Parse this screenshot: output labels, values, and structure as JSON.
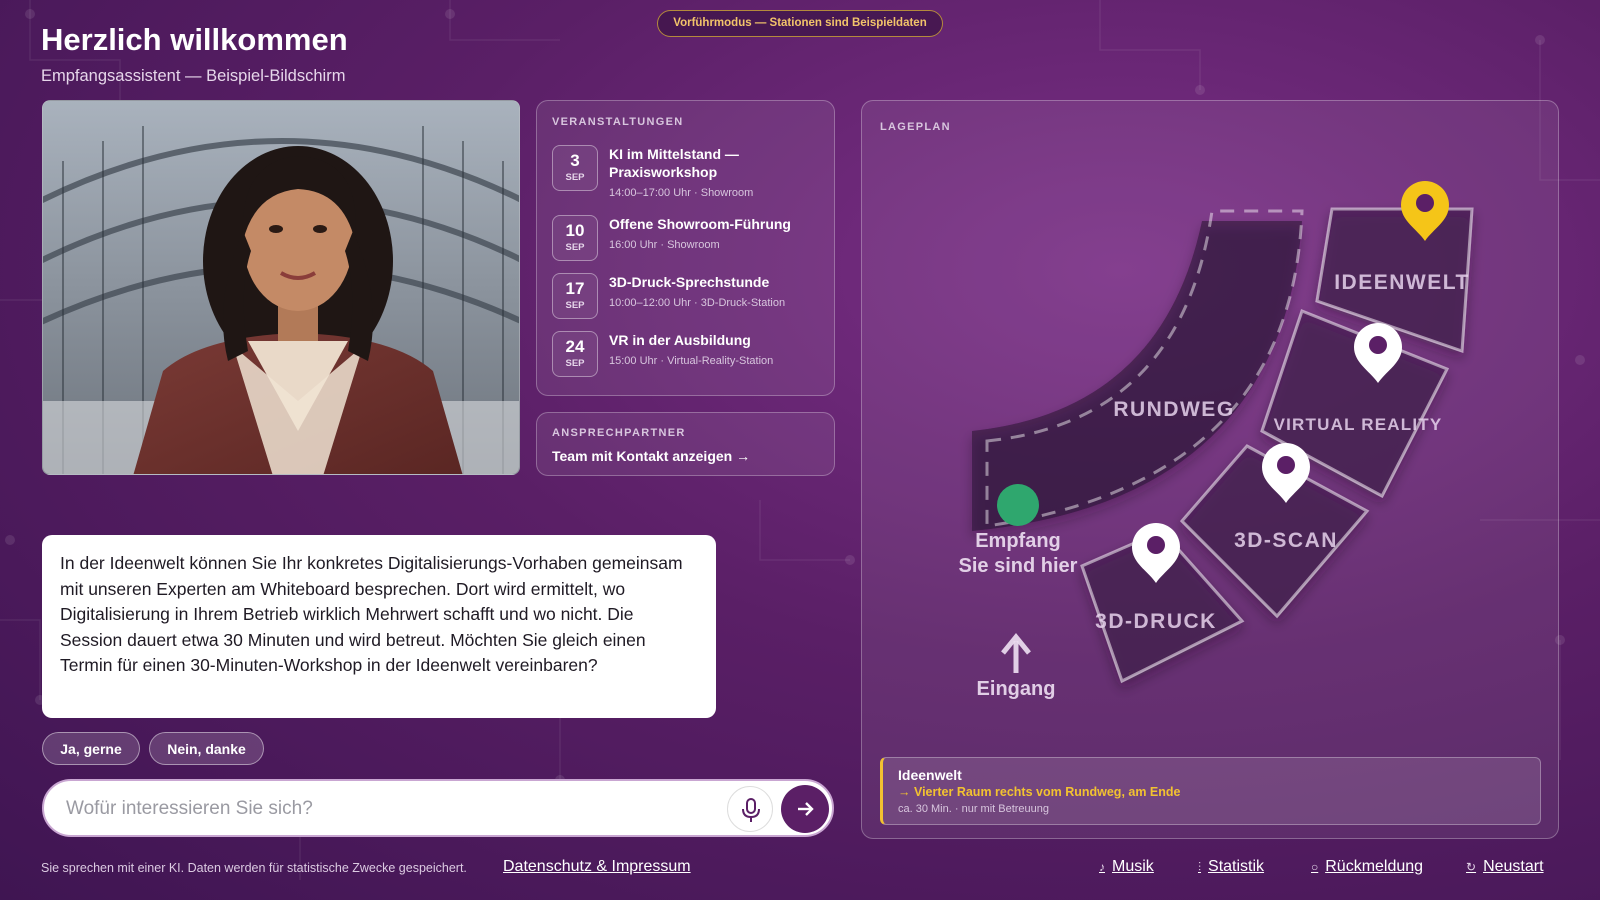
{
  "demo_badge": "Vorführmodus — Stationen sind Beispieldaten",
  "header": {
    "title": "Herzlich willkommen",
    "subtitle": "Empfangsassistent — Beispiel-Bildschirm"
  },
  "events": {
    "heading": "VERANSTALTUNGEN",
    "items": [
      {
        "day": "3",
        "month": "SEP",
        "title": "KI im Mittelstand — Praxisworkshop",
        "meta": "14:00–17:00 Uhr · Showroom"
      },
      {
        "day": "10",
        "month": "SEP",
        "title": "Offene Showroom-Führung",
        "meta": "16:00 Uhr · Showroom"
      },
      {
        "day": "17",
        "month": "SEP",
        "title": "3D-Druck-Sprechstunde",
        "meta": "10:00–12:00 Uhr · 3D-Druck-Station"
      },
      {
        "day": "24",
        "month": "SEP",
        "title": "VR in der Ausbildung",
        "meta": "15:00 Uhr · Virtual-Reality-Station"
      }
    ]
  },
  "contact": {
    "heading": "ANSPRECHPARTNER",
    "link": "Team mit Kontakt anzeigen →"
  },
  "chat": {
    "message": "In der Ideenwelt können Sie Ihr konkretes Digitalisierungs-Vorhaben gemeinsam mit unseren Experten am Whiteboard besprechen. Dort wird ermittelt, wo Digitalisierung in Ihrem Betrieb wirklich Mehrwert schafft und wo nicht. Die Session dauert etwa 30 Minuten und wird betreut. Möchten Sie gleich einen Termin für einen 30-Minuten-Workshop in der Ideenwelt vereinbaren?",
    "reply_yes": "Ja, gerne",
    "reply_no": "Nein, danke",
    "input_placeholder": "Wofür interessieren Sie sich?",
    "mic_icon": "microphone-icon",
    "send_icon": "arrow-right-icon"
  },
  "map": {
    "heading": "LAGEPLAN",
    "labels": {
      "rundweg": "RUNDWEG",
      "ideenwelt": "IDEENWELT",
      "virtual_reality": "VIRTUAL REALITY",
      "scan": "3D-SCAN",
      "druck": "3D-DRUCK",
      "empfang": "Empfang",
      "here": "Sie sind hier",
      "eingang": "Eingang"
    },
    "colors": {
      "highlight_pin": "#f5c518",
      "you_are_here": "#2fa76e"
    },
    "info": {
      "title": "Ideenwelt",
      "direction": "→ Vierter Raum rechts vom Rundweg, am Ende",
      "meta": "ca. 30 Min. · nur mit Betreuung"
    }
  },
  "footer": {
    "note": "Sie sprechen mit einer KI. Daten werden für statistische Zwecke gespeichert.",
    "privacy_link": "Datenschutz & Impressum",
    "items": [
      {
        "icon": "♪",
        "label": "Musik"
      },
      {
        "icon": "⫶",
        "label": "Statistik"
      },
      {
        "icon": "○",
        "label": "Rückmeldung"
      },
      {
        "icon": "↻",
        "label": "Neustart"
      }
    ]
  }
}
